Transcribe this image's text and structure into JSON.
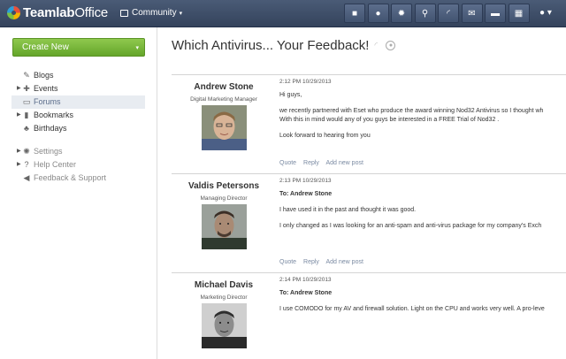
{
  "header": {
    "logo_bold": "Teamlab",
    "logo_light": "Office",
    "module": "Community",
    "icons": [
      "video-icon",
      "globe-icon",
      "settings-icon",
      "search-icon",
      "feed-icon",
      "mail-icon",
      "chat-icon",
      "calendar-icon"
    ],
    "user": "▾"
  },
  "sidebar": {
    "create_label": "Create New",
    "items": [
      {
        "label": "Blogs",
        "icon": "blog-icon",
        "expander": false
      },
      {
        "label": "Events",
        "icon": "events-icon",
        "expander": true
      },
      {
        "label": "Forums",
        "icon": "forums-icon",
        "expander": false,
        "active": true
      },
      {
        "label": "Bookmarks",
        "icon": "bookmark-icon",
        "expander": true
      },
      {
        "label": "Birthdays",
        "icon": "birthday-icon",
        "expander": false
      }
    ],
    "secondary": [
      {
        "label": "Settings",
        "icon": "gear-icon",
        "expander": true
      },
      {
        "label": "Help Center",
        "icon": "help-icon",
        "expander": true
      },
      {
        "label": "Feedback & Support",
        "icon": "megaphone-icon",
        "expander": false
      }
    ]
  },
  "main": {
    "title": "Which Antivirus... Your Feedback!",
    "actions": {
      "quote": "Quote",
      "reply": "Reply",
      "add": "Add new post"
    },
    "posts": [
      {
        "author": "Andrew Stone",
        "role": "Digital Marketing Manager",
        "meta": "2:12 PM 10/29/2013",
        "to": "",
        "paragraphs": [
          "Hi guys,",
          "we recently partnered with Eset who produce the award winning Nod32 Antivirus so I thought wh",
          "With this in mind would any of you guys be interested in a FREE Trial of Nod32 .",
          "Look forward to hearing from you"
        ]
      },
      {
        "author": "Valdis Petersons",
        "role": "Managing Director",
        "meta": "2:13 PM 10/29/2013",
        "to": "To: Andrew Stone",
        "paragraphs": [
          "I have used it in the past and thought it was good.",
          "I only changed as I was looking for an anti-spam and anti-virus package for my company's Exch"
        ]
      },
      {
        "author": "Michael Davis",
        "role": "Marketing Director",
        "meta": "2:14 PM 10/29/2013",
        "to": "To: Andrew Stone",
        "paragraphs": [
          "I use COMODO for my AV and firewall solution. Light on the CPU and works very well. A pro-leve"
        ]
      }
    ]
  }
}
